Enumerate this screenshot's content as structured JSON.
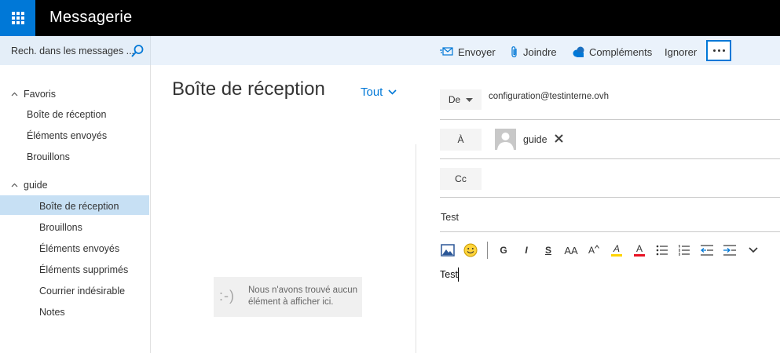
{
  "app": {
    "title": "Messagerie"
  },
  "search": {
    "placeholder": "Rech. dans les messages ..."
  },
  "commands": {
    "send": "Envoyer",
    "attach": "Joindre",
    "addins": "Compléments",
    "discard": "Ignorer"
  },
  "nav": {
    "favorites": {
      "label": "Favoris",
      "items": [
        "Boîte de réception",
        "Éléments envoyés",
        "Brouillons"
      ]
    },
    "account": {
      "label": "guide",
      "items": [
        "Boîte de réception",
        "Brouillons",
        "Éléments envoyés",
        "Éléments supprimés",
        "Courrier indésirable",
        "Notes"
      ],
      "selected": "Boîte de réception"
    }
  },
  "list": {
    "title": "Boîte de réception",
    "filter": "Tout",
    "empty_face": ":-)",
    "empty_message": "Nous n'avons trouvé aucun élément à afficher ici."
  },
  "compose": {
    "from_label": "De",
    "from_address": "configuration@testinterne.ovh",
    "to_label": "À",
    "to_recipient": "guide",
    "cc_label": "Cc",
    "subject": "Test",
    "body": "Test"
  },
  "format": {
    "bold": "G",
    "italic": "I",
    "strike": "S",
    "font_size": "AA",
    "grow": "A",
    "highlight": "A",
    "font_color": "A"
  },
  "colors": {
    "accent": "#0078d7",
    "topbar": "#000000",
    "selected_nav": "#c7e0f4",
    "command_bar": "#eaf2fb"
  }
}
